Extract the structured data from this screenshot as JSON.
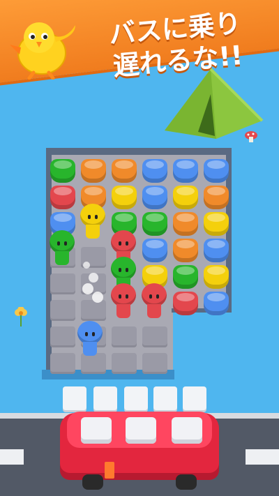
{
  "banner": {
    "line1": "バスに乗り",
    "line2": "遅れるな!!"
  },
  "colors": {
    "banner": "#f07c1e",
    "water": "#4fb6ef",
    "bus": "#e3263e",
    "green": "#28b52c",
    "orange": "#f08a2a",
    "yellow": "#f4d00c",
    "blue": "#4f8ff0",
    "red": "#e3474d"
  },
  "board": {
    "peg_grid": [
      [
        "green",
        "orange",
        "orange",
        "blue",
        "blue",
        "blue"
      ],
      [
        "red",
        "orange",
        "yellow",
        "blue",
        "yellow",
        "orange"
      ],
      [
        "blue",
        "yellow",
        "green",
        "green",
        "orange",
        "yellow"
      ],
      [
        "green",
        "",
        "red",
        "blue",
        "orange",
        "blue"
      ],
      [
        "",
        "",
        "green",
        "yellow",
        "green",
        "yellow"
      ],
      [
        "",
        "",
        "red",
        "red",
        "red",
        "blue"
      ]
    ],
    "walking_person": "blue",
    "slots_empty": 5
  },
  "scene": {
    "icons": [
      "bird-mascot-icon",
      "tent-icon",
      "mushroom-icon",
      "flower-icon",
      "bus-icon"
    ]
  }
}
